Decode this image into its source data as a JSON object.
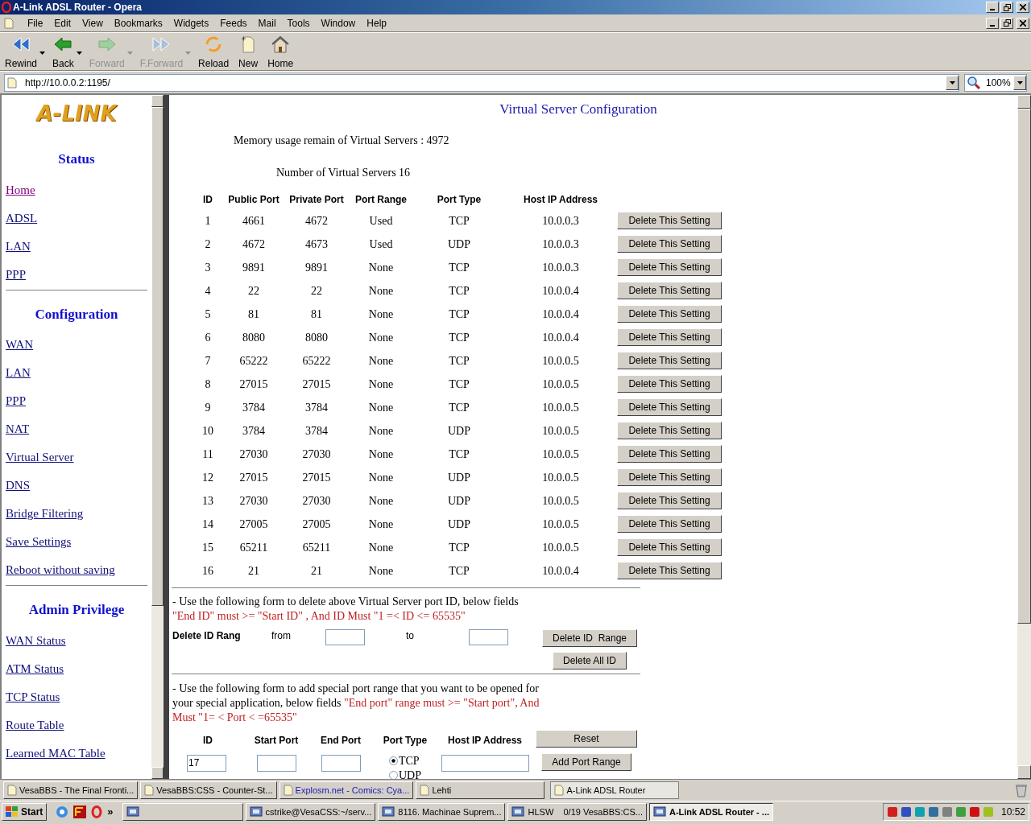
{
  "window": {
    "title": "A-Link ADSL Router - Opera"
  },
  "menu": [
    "File",
    "Edit",
    "View",
    "Bookmarks",
    "Widgets",
    "Feeds",
    "Mail",
    "Tools",
    "Window",
    "Help"
  ],
  "toolbar": [
    {
      "kind": "rewind",
      "label": "Rewind",
      "disabled": false,
      "dropdown": true
    },
    {
      "kind": "back",
      "label": "Back",
      "disabled": false,
      "dropdown": true
    },
    {
      "kind": "forward",
      "label": "Forward",
      "disabled": true,
      "dropdown": true
    },
    {
      "kind": "fforward",
      "label": "F.Forward",
      "disabled": true,
      "dropdown": true
    },
    {
      "kind": "reload",
      "label": "Reload",
      "disabled": false,
      "dropdown": false
    },
    {
      "kind": "new",
      "label": "New",
      "disabled": false,
      "dropdown": false
    },
    {
      "kind": "home",
      "label": "Home",
      "disabled": false,
      "dropdown": false
    }
  ],
  "address": {
    "url": "http://10.0.0.2:1195/",
    "zoom": "100%"
  },
  "sidebar": {
    "logo": "A-LINK",
    "sections": [
      {
        "title": "Status",
        "links": [
          {
            "label": "Home",
            "visited": true
          },
          {
            "label": "ADSL",
            "visited": false
          },
          {
            "label": "LAN",
            "visited": false
          },
          {
            "label": "PPP",
            "visited": false
          }
        ]
      },
      {
        "title": "Configuration",
        "links": [
          {
            "label": "WAN",
            "visited": false
          },
          {
            "label": "LAN",
            "visited": false
          },
          {
            "label": "PPP",
            "visited": false
          },
          {
            "label": "NAT",
            "visited": false
          },
          {
            "label": "Virtual Server",
            "visited": false
          },
          {
            "label": "DNS",
            "visited": false
          },
          {
            "label": "Bridge Filtering",
            "visited": false
          },
          {
            "label": "Save Settings",
            "visited": false
          },
          {
            "label": "Reboot without saving",
            "visited": false
          }
        ]
      },
      {
        "title": "Admin Privilege",
        "links": [
          {
            "label": "WAN Status",
            "visited": false
          },
          {
            "label": "ATM Status",
            "visited": false
          },
          {
            "label": "TCP Status",
            "visited": false
          },
          {
            "label": "Route Table",
            "visited": false
          },
          {
            "label": "Learned MAC Table",
            "visited": false
          }
        ]
      }
    ]
  },
  "main": {
    "heading": "Virtual Server Configuration",
    "memory": "Memory usage remain of Virtual Servers : 4972",
    "count": "Number of Virtual Servers 16",
    "table": {
      "columns": [
        "ID",
        "Public Port",
        "Private Port",
        "Port Range",
        "Port Type",
        "Host IP Address"
      ],
      "rows": [
        {
          "cells": [
            "1",
            "4661",
            "4672",
            "Used",
            "TCP",
            "10.0.0.3"
          ],
          "action": "Delete This Setting"
        },
        {
          "cells": [
            "2",
            "4672",
            "4673",
            "Used",
            "UDP",
            "10.0.0.3"
          ],
          "action": "Delete This Setting"
        },
        {
          "cells": [
            "3",
            "9891",
            "9891",
            "None",
            "TCP",
            "10.0.0.3"
          ],
          "action": "Delete This Setting"
        },
        {
          "cells": [
            "4",
            "22",
            "22",
            "None",
            "TCP",
            "10.0.0.4"
          ],
          "action": "Delete This Setting"
        },
        {
          "cells": [
            "5",
            "81",
            "81",
            "None",
            "TCP",
            "10.0.0.4"
          ],
          "action": "Delete This Setting"
        },
        {
          "cells": [
            "6",
            "8080",
            "8080",
            "None",
            "TCP",
            "10.0.0.4"
          ],
          "action": "Delete This Setting"
        },
        {
          "cells": [
            "7",
            "65222",
            "65222",
            "None",
            "TCP",
            "10.0.0.5"
          ],
          "action": "Delete This Setting"
        },
        {
          "cells": [
            "8",
            "27015",
            "27015",
            "None",
            "TCP",
            "10.0.0.5"
          ],
          "action": "Delete This Setting"
        },
        {
          "cells": [
            "9",
            "3784",
            "3784",
            "None",
            "TCP",
            "10.0.0.5"
          ],
          "action": "Delete This Setting"
        },
        {
          "cells": [
            "10",
            "3784",
            "3784",
            "None",
            "UDP",
            "10.0.0.5"
          ],
          "action": "Delete This Setting"
        },
        {
          "cells": [
            "11",
            "27030",
            "27030",
            "None",
            "TCP",
            "10.0.0.5"
          ],
          "action": "Delete This Setting"
        },
        {
          "cells": [
            "12",
            "27015",
            "27015",
            "None",
            "UDP",
            "10.0.0.5"
          ],
          "action": "Delete This Setting"
        },
        {
          "cells": [
            "13",
            "27030",
            "27030",
            "None",
            "UDP",
            "10.0.0.5"
          ],
          "action": "Delete This Setting"
        },
        {
          "cells": [
            "14",
            "27005",
            "27005",
            "None",
            "UDP",
            "10.0.0.5"
          ],
          "action": "Delete This Setting"
        },
        {
          "cells": [
            "15",
            "65211",
            "65211",
            "None",
            "TCP",
            "10.0.0.5"
          ],
          "action": "Delete This Setting"
        },
        {
          "cells": [
            "16",
            "21",
            "21",
            "None",
            "TCP",
            "10.0.0.4"
          ],
          "action": "Delete This Setting"
        }
      ]
    },
    "delete_form": {
      "note": [
        {
          "kind": "plain",
          "text": "- Use the following form to delete above Virtual Server port ID, below fields"
        },
        {
          "kind": "warning",
          "text": "\"End ID\" must >= \"Start ID\" , And ID Must \"1 =< ID <= 65535\""
        }
      ],
      "label": "Delete ID Rang",
      "from": "from",
      "to": "to",
      "buttons": [
        "Delete ID  Range",
        "Delete All ID"
      ]
    },
    "add_form": {
      "note": [
        {
          "kind": "plain",
          "text": "- Use the following form to add special port range that you want to be opened for your special application, below fields"
        },
        {
          "kind": "warning",
          "text": "\"End port\" range must >= \"Start port\", And Must \"1= < Port < =65535\""
        }
      ],
      "columns": [
        "ID",
        "Start Port",
        "End Port",
        "Port Type",
        "Host IP Address"
      ],
      "id_value": "17",
      "port_types": [
        {
          "label": "TCP",
          "selected": true
        },
        {
          "label": "UDP",
          "selected": false
        }
      ],
      "buttons": [
        "Reset",
        "Add Port Range"
      ]
    }
  },
  "tabs": [
    {
      "label": "VesaBBS - The Final Fronti...",
      "selected": false
    },
    {
      "label": "VesaBBS:CSS - Counter-St...",
      "selected": false
    },
    {
      "label": "Explosm.net - Comics: Cya...",
      "selected": false
    },
    {
      "label": "Lehti",
      "selected": false
    },
    {
      "label": "A-Link ADSL Router",
      "selected": true
    }
  ],
  "taskbar": {
    "start": "Start",
    "more": "»",
    "tasks": [
      {
        "selected": false
      },
      {
        "label": "cstrike@VesaCSS:~/serv...",
        "selected": false
      },
      {
        "label": "8116. Machinae Suprem...",
        "selected": false
      },
      {
        "label": "HLSW    0/19 VesaBBS:CS...",
        "selected": false
      },
      {
        "label": "A-Link ADSL Router - ...",
        "selected": true
      }
    ],
    "clock": "10:52"
  }
}
